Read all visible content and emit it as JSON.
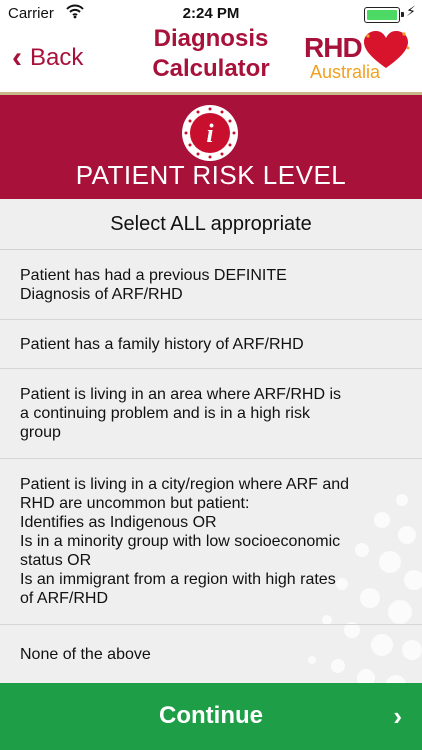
{
  "status_bar": {
    "carrier": "Carrier",
    "time": "2:24 PM"
  },
  "nav": {
    "back_label": "Back",
    "title_line1": "Diagnosis",
    "title_line2": "Calculator",
    "logo_rhd": "RHD",
    "logo_australia": "Australia"
  },
  "banner": {
    "title": "PATIENT RISK LEVEL",
    "icon_letter": "i"
  },
  "list": {
    "header": "Select ALL appropriate",
    "options": [
      {
        "lines": [
          "Patient has had a previous DEFINITE",
          "Diagnosis of ARF/RHD"
        ]
      },
      {
        "lines": [
          "Patient has a family history of ARF/RHD"
        ]
      },
      {
        "lines": [
          "Patient is living in an area where ARF/RHD is",
          "a continuing problem and is in a high risk",
          "group"
        ]
      },
      {
        "lines": [
          "Patient is living in a city/region where ARF and",
          "RHD are uncommon but patient:",
          "Identifies as Indigenous OR",
          "Is in a minority group with low socioeconomic",
          "status OR",
          "Is an immigrant from a region with high rates",
          "of ARF/RHD"
        ]
      },
      {
        "lines": [
          "None of the above"
        ]
      }
    ]
  },
  "continue": {
    "label": "Continue",
    "arrow": "›"
  },
  "colors": {
    "brand": "#a8113a",
    "accent_orange": "#f2a01f",
    "continue_green": "#1e9e46",
    "battery_green": "#4cd964"
  },
  "icons": [
    "wifi-icon",
    "battery-icon",
    "charging-bolt-icon",
    "chevron-left-icon",
    "heart-logo-icon",
    "info-icon",
    "chevron-right-icon"
  ]
}
